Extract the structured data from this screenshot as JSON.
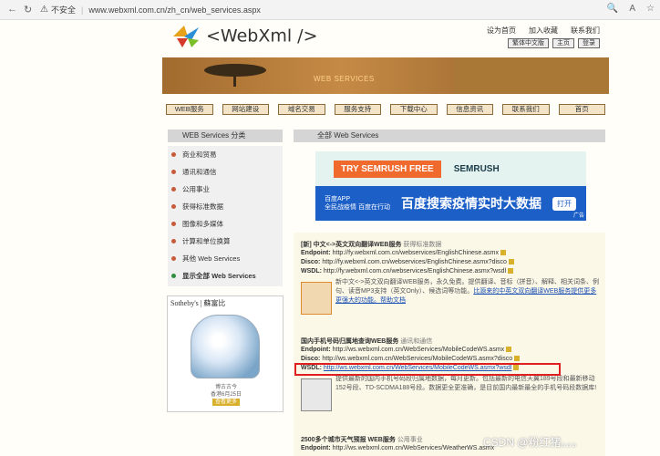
{
  "browser": {
    "insecure_label": "不安全",
    "url": "www.webxml.com.cn/zh_cn/web_services.aspx"
  },
  "header": {
    "logo_text": "<WebXml />",
    "top_links": [
      "设为首页",
      "加入收藏",
      "联系我们"
    ],
    "top_buttons": [
      "繁体中文版",
      "主页",
      "登录"
    ]
  },
  "banner": {
    "text": "WEB SERVICES"
  },
  "nav": [
    "WEB服务",
    "网站建设",
    "域名交易",
    "服务支持",
    "下载中心",
    "信息资讯",
    "联系我们",
    "首页"
  ],
  "sidebar": {
    "heading": "WEB Services 分类",
    "items": [
      "商业和贸易",
      "通讯和通信",
      "公用事业",
      "获得标准数据",
      "图像和多媒体",
      "计算和单位换算",
      "其他 Web Services",
      "显示全部 Web Services"
    ],
    "ad_brand": "Sotheby's | 蘇富比",
    "ad_caption_1": "博古古今",
    "ad_caption_2": "香港6月25日",
    "ad_caption_3": "查看更多"
  },
  "main": {
    "heading": "全部 Web Services",
    "ad_top_button": "TRY SEMRUSH FREE",
    "ad_top_brand": "SEMRUSH",
    "ad_bot_small_1": "百度APP",
    "ad_bot_small_2": "全民战疫情 百度在行动",
    "ad_bot_big": "百度搜索疫情实时大数据",
    "ad_bot_btn": "打开",
    "ad_label": "广告"
  },
  "services": [
    {
      "title": "[新] 中文<->英文双向翻译WEB服务",
      "category": "获得标准数据",
      "endpoint": "http://fy.webxml.com.cn/webservices/EnglishChinese.asmx",
      "disco": "http://fy.webxml.com.cn/webservices/EnglishChinese.asmx?disco",
      "wsdl": "http://fy.webxml.com.cn/webservices/EnglishChinese.asmx?wsdl",
      "desc": "新中文<->英文双向翻译WEB服务，永久免费。提供翻译、音标（拼音）、解释、相关词条、例句、读音MP3支持（英文Only）、候选词等功能。",
      "desc_link": "比源来的中英文双向翻译WEB服务提供更多更强大的功能。帮助文档"
    },
    {
      "title": "国内手机号码归属地查询WEB服务",
      "category": "通讯和通信",
      "endpoint": "http://ws.webxml.com.cn/WebServices/MobileCodeWS.asmx",
      "disco": "http://ws.webxml.com.cn/WebServices/MobileCodeWS.asmx?disco",
      "wsdl": "http://ws.webxml.com.cn/WebServices/MobileCodeWS.asmx?wsdl",
      "desc": "提供最新的国内手机号码段归属地数据，每月更新。包括最新的电信天翼189号段和最新移动152号段、TD-SCDMA188号段。数据更全更准确，是目前国内最新最全的手机号码段数据库!"
    },
    {
      "title": "2500多个城市天气预报 WEB服务",
      "category": "公用事业",
      "endpoint": "http://ws.webxml.com.cn/WebServices/WeatherWS.asmx"
    }
  ],
  "labels": {
    "endpoint": "Endpoint:",
    "disco": "Disco:",
    "wsdl": "WSDL:"
  },
  "watermark": "CSDN @粉红猪。。。"
}
